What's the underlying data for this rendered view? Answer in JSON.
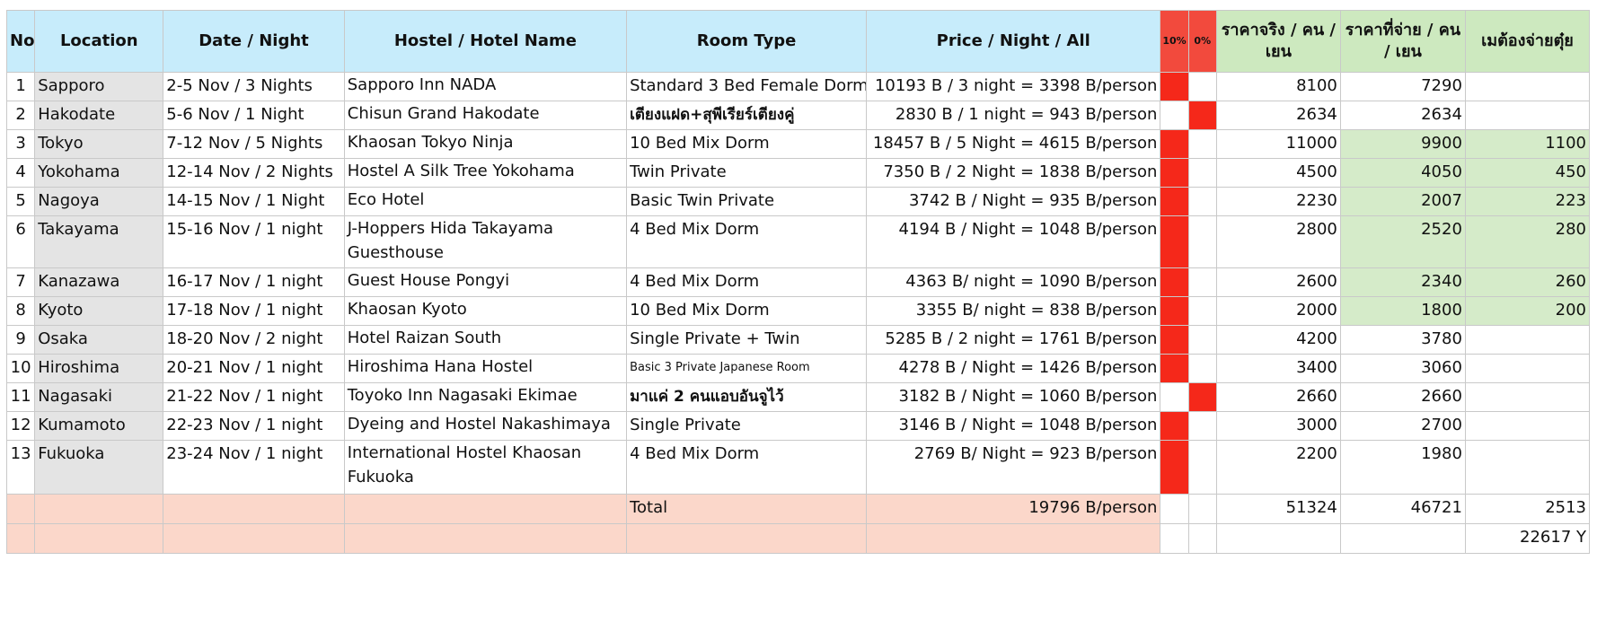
{
  "headers": {
    "no": "No",
    "location": "Location",
    "date": "Date / Night",
    "hostel": "Hostel / Hotel Name",
    "room": "Room Type",
    "price": "Price / Night / All",
    "p10": "10%",
    "p0": "0%",
    "real": "ราคาจริง / คน / เยน",
    "paid": "ราคาที่จ่าย / คน / เยน",
    "owe": "เมต้องจ่ายตุ๋ย"
  },
  "rows": [
    {
      "no": "1",
      "location": "Sapporo",
      "date": "2-5 Nov / 3 Nights",
      "hostel": "Sapporo Inn NADA",
      "room": "Standard 3 Bed Female Dorm",
      "price": "10193 B / 3 night = 3398 B/person",
      "real": "8100",
      "paid": "7290",
      "owe": ""
    },
    {
      "no": "2",
      "location": "Hakodate",
      "date": "5-6 Nov / 1 Night",
      "hostel": "Chisun Grand Hakodate",
      "room": "เตียงแฝด+สุพีเรียร์เตียงคู่",
      "price": "2830 B / 1 night = 943 B/person",
      "real": "2634",
      "paid": "2634",
      "owe": ""
    },
    {
      "no": "3",
      "location": "Tokyo",
      "date": "7-12 Nov / 5 Nights",
      "hostel": "Khaosan Tokyo Ninja",
      "room": "10 Bed Mix Dorm",
      "price": "18457 B / 5 Night = 4615 B/person",
      "real": "11000",
      "paid": "9900",
      "owe": "1100"
    },
    {
      "no": "4",
      "location": "Yokohama",
      "date": "12-14 Nov / 2 Nights",
      "hostel": "Hostel A Silk Tree Yokohama",
      "room": "Twin Private",
      "price": "7350 B / 2 Night = 1838 B/person",
      "real": "4500",
      "paid": "4050",
      "owe": "450"
    },
    {
      "no": "5",
      "location": "Nagoya",
      "date": "14-15 Nov / 1 Night",
      "hostel": "Eco Hotel",
      "room": "Basic Twin Private",
      "price": "3742 B / Night = 935 B/person",
      "real": "2230",
      "paid": "2007",
      "owe": "223"
    },
    {
      "no": "6",
      "location": "Takayama",
      "date": "15-16 Nov / 1 night",
      "hostel": "J-Hoppers Hida Takayama Guesthouse",
      "room": "4 Bed Mix Dorm",
      "price": "4194 B / Night = 1048 B/person",
      "real": "2800",
      "paid": "2520",
      "owe": "280"
    },
    {
      "no": "7",
      "location": "Kanazawa",
      "date": "16-17 Nov / 1 night",
      "hostel": "Guest House Pongyi",
      "room": "4 Bed Mix Dorm",
      "price": "4363 B/ night = 1090 B/person",
      "real": "2600",
      "paid": "2340",
      "owe": "260"
    },
    {
      "no": "8",
      "location": "Kyoto",
      "date": "17-18 Nov / 1 night",
      "hostel": "Khaosan Kyoto",
      "room": "10 Bed Mix Dorm",
      "price": "3355 B/ night = 838 B/person",
      "real": "2000",
      "paid": "1800",
      "owe": "200"
    },
    {
      "no": "9",
      "location": "Osaka",
      "date": "18-20 Nov / 2 night",
      "hostel": "Hotel Raizan South",
      "room": "Single Private + Twin",
      "price": "5285 B / 2 night = 1761 B/person",
      "real": "4200",
      "paid": "3780",
      "owe": ""
    },
    {
      "no": "10",
      "location": "Hiroshima",
      "date": "20-21 Nov / 1 night",
      "hostel": "Hiroshima Hana Hostel",
      "room": "Basic 3 Private Japanese Room",
      "price": "4278 B / Night = 1426 B/person",
      "real": "3400",
      "paid": "3060",
      "owe": ""
    },
    {
      "no": "11",
      "location": "Nagasaki",
      "date": "21-22 Nov / 1 night",
      "hostel": "Toyoko Inn Nagasaki Ekimae",
      "room": "มาแค่ 2 คนแอบอันจูไว้",
      "price": "3182 B / Night = 1060 B/person",
      "real": "2660",
      "paid": "2660",
      "owe": ""
    },
    {
      "no": "12",
      "location": "Kumamoto",
      "date": "22-23 Nov / 1 night",
      "hostel": "Dyeing and Hostel Nakashimaya",
      "room": "Single Private",
      "price": "3146 B / Night = 1048 B/person",
      "real": "3000",
      "paid": "2700",
      "owe": ""
    },
    {
      "no": "13",
      "location": "Fukuoka",
      "date": "23-24 Nov / 1 night",
      "hostel": "International Hostel Khaosan Fukuoka",
      "room": "4 Bed Mix Dorm",
      "price": "2769 B/ Night = 923 B/person",
      "real": "2200",
      "paid": "1980",
      "owe": ""
    }
  ],
  "totals": {
    "label": "Total",
    "price": "19796 B/person",
    "real": "51324",
    "paid": "46721",
    "owe": "2513",
    "grand": "22617 Y"
  },
  "colors": {
    "header_blue": "#c7ecfb",
    "header_green": "#cde9bf",
    "marker_red": "#f5281a",
    "owe_green": "#d5ebc9",
    "total_pink": "#fbd7ca",
    "location_gray": "#e4e4e4"
  }
}
